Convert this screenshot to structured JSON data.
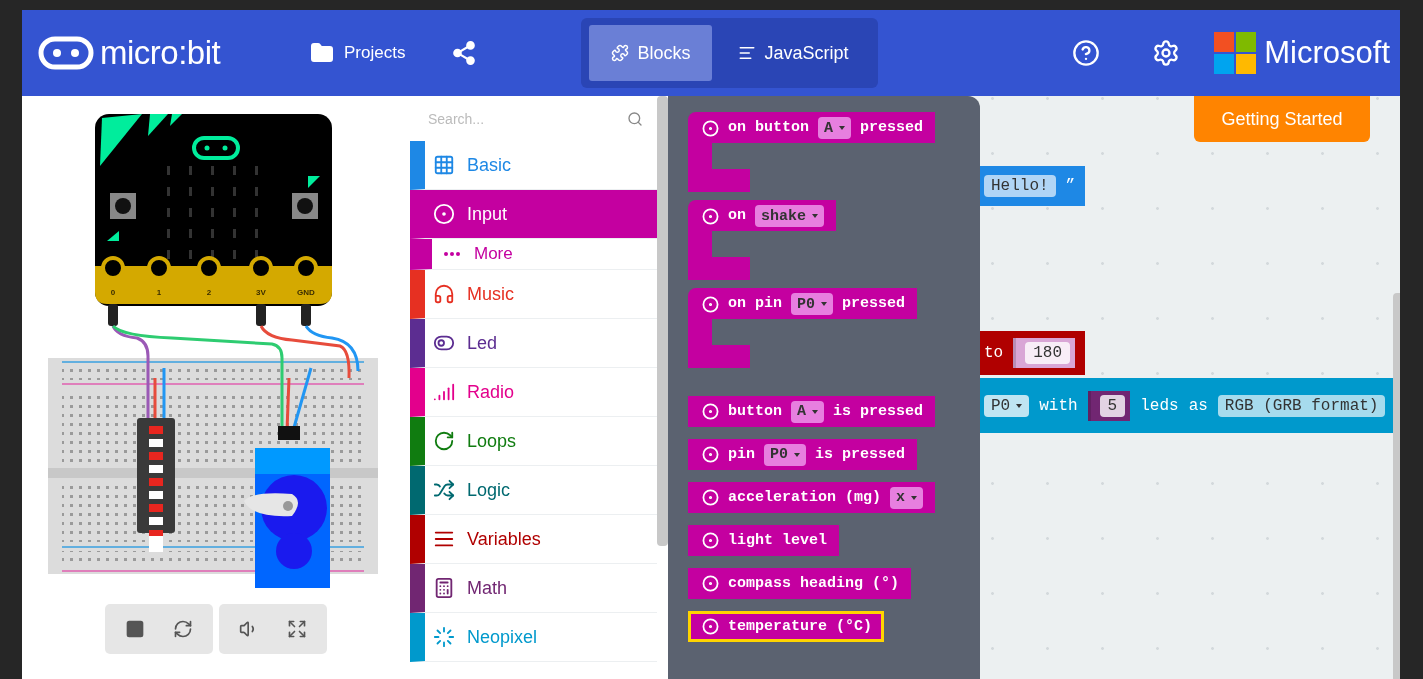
{
  "header": {
    "logo": "micro:bit",
    "projects": "Projects",
    "tabs": [
      {
        "kind": "blocks",
        "label": "Blocks",
        "selected": true
      },
      {
        "kind": "code",
        "label": "JavaScript",
        "selected": false
      }
    ],
    "brand": "Microsoft"
  },
  "simulator": {
    "pins": [
      "0",
      "1",
      "2",
      "3V",
      "GND"
    ]
  },
  "toolbox": {
    "search": {
      "placeholder": "Search..."
    },
    "categories": [
      {
        "kind": "basic",
        "label": "Basic",
        "color": "#1e88e5",
        "selected": false
      },
      {
        "kind": "input",
        "label": "Input",
        "color": "#c400a0",
        "selected": true,
        "children": [
          {
            "label": "More"
          }
        ]
      },
      {
        "kind": "music",
        "label": "Music",
        "color": "#e63022",
        "selected": false
      },
      {
        "kind": "led",
        "label": "Led",
        "color": "#5c2d91",
        "selected": false
      },
      {
        "kind": "radio",
        "label": "Radio",
        "color": "#e3008c",
        "selected": false
      },
      {
        "kind": "loops",
        "label": "Loops",
        "color": "#107c10",
        "selected": false
      },
      {
        "kind": "logic",
        "label": "Logic",
        "color": "#006970",
        "selected": false
      },
      {
        "kind": "variables",
        "label": "Variables",
        "color": "#b00000",
        "selected": false
      },
      {
        "kind": "math",
        "label": "Math",
        "color": "#712672",
        "selected": false
      },
      {
        "kind": "neopixel",
        "label": "Neopixel",
        "color": "#0099cc",
        "selected": false
      }
    ]
  },
  "flyout": {
    "blocks": [
      {
        "kind": "hat",
        "selected": false,
        "parts": [
          {
            "kind": "text",
            "text": "on button"
          },
          {
            "kind": "dropdown",
            "text": "A"
          },
          {
            "kind": "text",
            "text": "pressed"
          }
        ]
      },
      {
        "kind": "hat",
        "selected": false,
        "parts": [
          {
            "kind": "text",
            "text": "on"
          },
          {
            "kind": "dropdown",
            "text": "shake"
          }
        ]
      },
      {
        "kind": "hat",
        "selected": false,
        "parts": [
          {
            "kind": "text",
            "text": "on pin"
          },
          {
            "kind": "dropdown",
            "text": "P0"
          },
          {
            "kind": "text",
            "text": "pressed"
          }
        ]
      },
      {
        "kind": "reporter",
        "selected": false,
        "parts": [
          {
            "kind": "text",
            "text": "button"
          },
          {
            "kind": "dropdown",
            "text": "A"
          },
          {
            "kind": "text",
            "text": "is pressed"
          }
        ]
      },
      {
        "kind": "reporter",
        "selected": false,
        "parts": [
          {
            "kind": "text",
            "text": "pin"
          },
          {
            "kind": "dropdown",
            "text": "P0"
          },
          {
            "kind": "text",
            "text": "is pressed"
          }
        ]
      },
      {
        "kind": "reporter",
        "selected": false,
        "parts": [
          {
            "kind": "text",
            "text": "acceleration (mg)"
          },
          {
            "kind": "dropdown",
            "text": "x"
          }
        ]
      },
      {
        "kind": "reporter",
        "selected": false,
        "parts": [
          {
            "kind": "text",
            "text": "light level"
          }
        ]
      },
      {
        "kind": "reporter",
        "selected": false,
        "parts": [
          {
            "kind": "text",
            "text": "compass heading (°)"
          }
        ]
      },
      {
        "kind": "reporter",
        "selected": true,
        "parts": [
          {
            "kind": "text",
            "text": "temperature (°C)"
          }
        ]
      }
    ]
  },
  "workspace": {
    "button": "Getting Started",
    "blocks": [
      {
        "kind": "string",
        "color": "#1e88e5",
        "parts": [
          {
            "kind": "field",
            "text": "Hello!"
          },
          {
            "kind": "text",
            "text": "”"
          }
        ]
      },
      {
        "kind": "servo",
        "color": "#b00000",
        "parts": [
          {
            "kind": "text",
            "text": "to"
          },
          {
            "kind": "number",
            "text": "180",
            "color": "#d9a6d6"
          }
        ]
      },
      {
        "kind": "neopixel",
        "color": "#0099cc",
        "parts": [
          {
            "kind": "dropdown",
            "text": "P0"
          },
          {
            "kind": "text",
            "text": "with"
          },
          {
            "kind": "number",
            "text": "5",
            "color": "#712672"
          },
          {
            "kind": "text",
            "text": "leds"
          },
          {
            "kind": "text",
            "text": "as"
          },
          {
            "kind": "field",
            "text": "RGB (GRB format)"
          }
        ]
      }
    ]
  }
}
